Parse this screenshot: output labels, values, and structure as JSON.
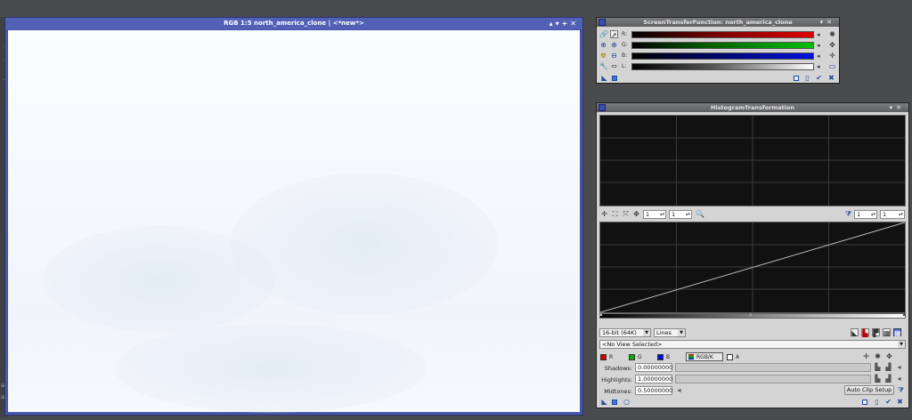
{
  "image_window": {
    "title": "RGB 1:5 north_america_clone | <*new*>",
    "side_tab": "north_america_clone"
  },
  "stf": {
    "title": "ScreenTransferFunction: north_america_clone",
    "channels": [
      {
        "label": "R:",
        "color": "#d00000"
      },
      {
        "label": "G:",
        "color": "#00b000"
      },
      {
        "label": "B:",
        "color": "#0010d8"
      },
      {
        "label": "L:",
        "color": "#cccccc"
      }
    ]
  },
  "hist": {
    "title": "HistogramTransformation",
    "zoom_h": "1",
    "zoom_v": "1",
    "zoom_h2": "1",
    "zoom_v2": "1",
    "resolution": "16-bit (64K)",
    "graph_style": "Lines",
    "view_selector": "<No View Selected>",
    "channels": [
      {
        "label": "R",
        "color": "#d00000"
      },
      {
        "label": "G",
        "color": "#00b000"
      },
      {
        "label": "B",
        "color": "#0010d8"
      },
      {
        "label": "RGB/K",
        "color": "#888888"
      },
      {
        "label": "A",
        "color": "#ffffff"
      }
    ],
    "shadows_label": "Shadows:",
    "shadows_value": "0.00000000",
    "highlights_label": "Highlights:",
    "highlights_value": "1.00000000",
    "midtones_label": "Midtones:",
    "midtones_value": "0.50000000",
    "auto_clip_label": "Auto Clip Setup"
  },
  "colors": {
    "desktop": "#4a4b4d",
    "image_frame": "#4856a8",
    "dialog_bg": "#d4d4d4",
    "graph_bg": "#111111"
  }
}
